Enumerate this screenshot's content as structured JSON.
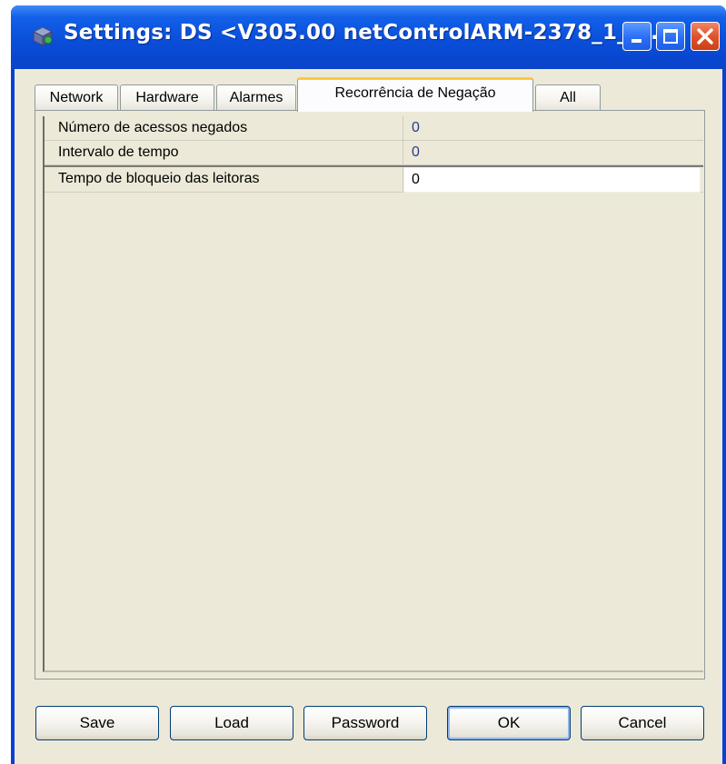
{
  "window": {
    "title": "Settings: DS <V305.00 netControlARM-2378_1_5...",
    "icon": "settings-app-icon",
    "controls": {
      "minimize": "minimize-icon",
      "maximize": "maximize-icon",
      "close": "close-icon"
    }
  },
  "tabs": [
    {
      "label": "Network",
      "active": false
    },
    {
      "label": "Hardware",
      "active": false
    },
    {
      "label": "Alarmes",
      "active": false
    },
    {
      "label": "Recorrência de Negação",
      "active": true
    },
    {
      "label": "All",
      "active": false
    }
  ],
  "properties": [
    {
      "name": "Número de acessos negados",
      "value": "0"
    },
    {
      "name": "Intervalo de tempo",
      "value": "0"
    },
    {
      "name": "Tempo de bloqueio das leitoras",
      "value": "0"
    }
  ],
  "buttons": {
    "save": "Save",
    "load": "Load",
    "password": "Password",
    "ok": "OK",
    "cancel": "Cancel"
  },
  "colors": {
    "titlebar": "#0a4fd9",
    "close_button": "#e0532b",
    "active_tab_highlight": "#ffc83c",
    "dialog_background": "#ece9d8",
    "property_value_text": "#2a3a8a"
  }
}
